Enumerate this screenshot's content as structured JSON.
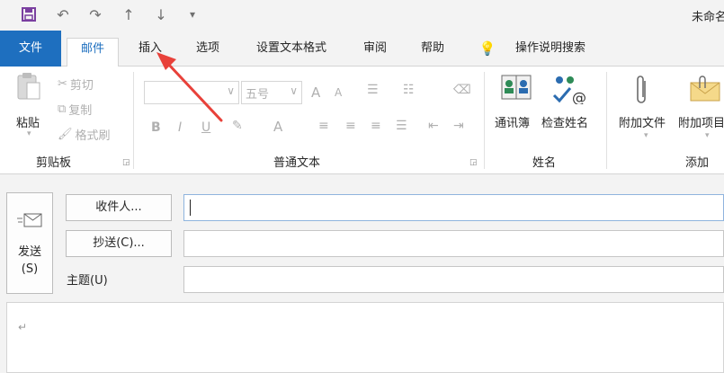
{
  "window": {
    "title": "未命名"
  },
  "qat": {
    "save_icon": "save-icon",
    "undo_icon": "undo-icon",
    "redo_icon": "redo-icon",
    "up_icon": "arrow-up-icon",
    "down_icon": "arrow-down-icon",
    "customize_icon": "customize-qat-icon"
  },
  "tabs": {
    "file": "文件",
    "message": "邮件",
    "insert": "插入",
    "options": "选项",
    "format_text": "设置文本格式",
    "review": "审阅",
    "help": "帮助",
    "tell_me": "操作说明搜索"
  },
  "ribbon": {
    "clipboard": {
      "label": "剪贴板",
      "paste": "粘贴",
      "cut": "剪切",
      "copy": "复制",
      "format_painter": "格式刷"
    },
    "basic_text": {
      "label": "普通文本",
      "font_size": "五号",
      "bold": "B",
      "italic": "I",
      "underline": "U",
      "font_color": "A",
      "grow_font": "A",
      "shrink_font": "A"
    },
    "names": {
      "label": "姓名",
      "address_book": "通讯簿",
      "check_names": "检查姓名"
    },
    "include": {
      "label": "添加",
      "attach_file": "附加文件",
      "attach_item": "附加项目"
    }
  },
  "compose": {
    "send_label": "发送",
    "send_shortcut": "(S)",
    "to_button": "收件人...",
    "cc_button": "抄送(C)...",
    "subject_label": "主题(U)",
    "to_value": "",
    "cc_value": "",
    "subject_value": "",
    "body_mark": "↵"
  },
  "colors": {
    "accent": "#1e6fbf",
    "annotation_arrow": "#e8413a",
    "chrome": "#f3f3f3"
  }
}
